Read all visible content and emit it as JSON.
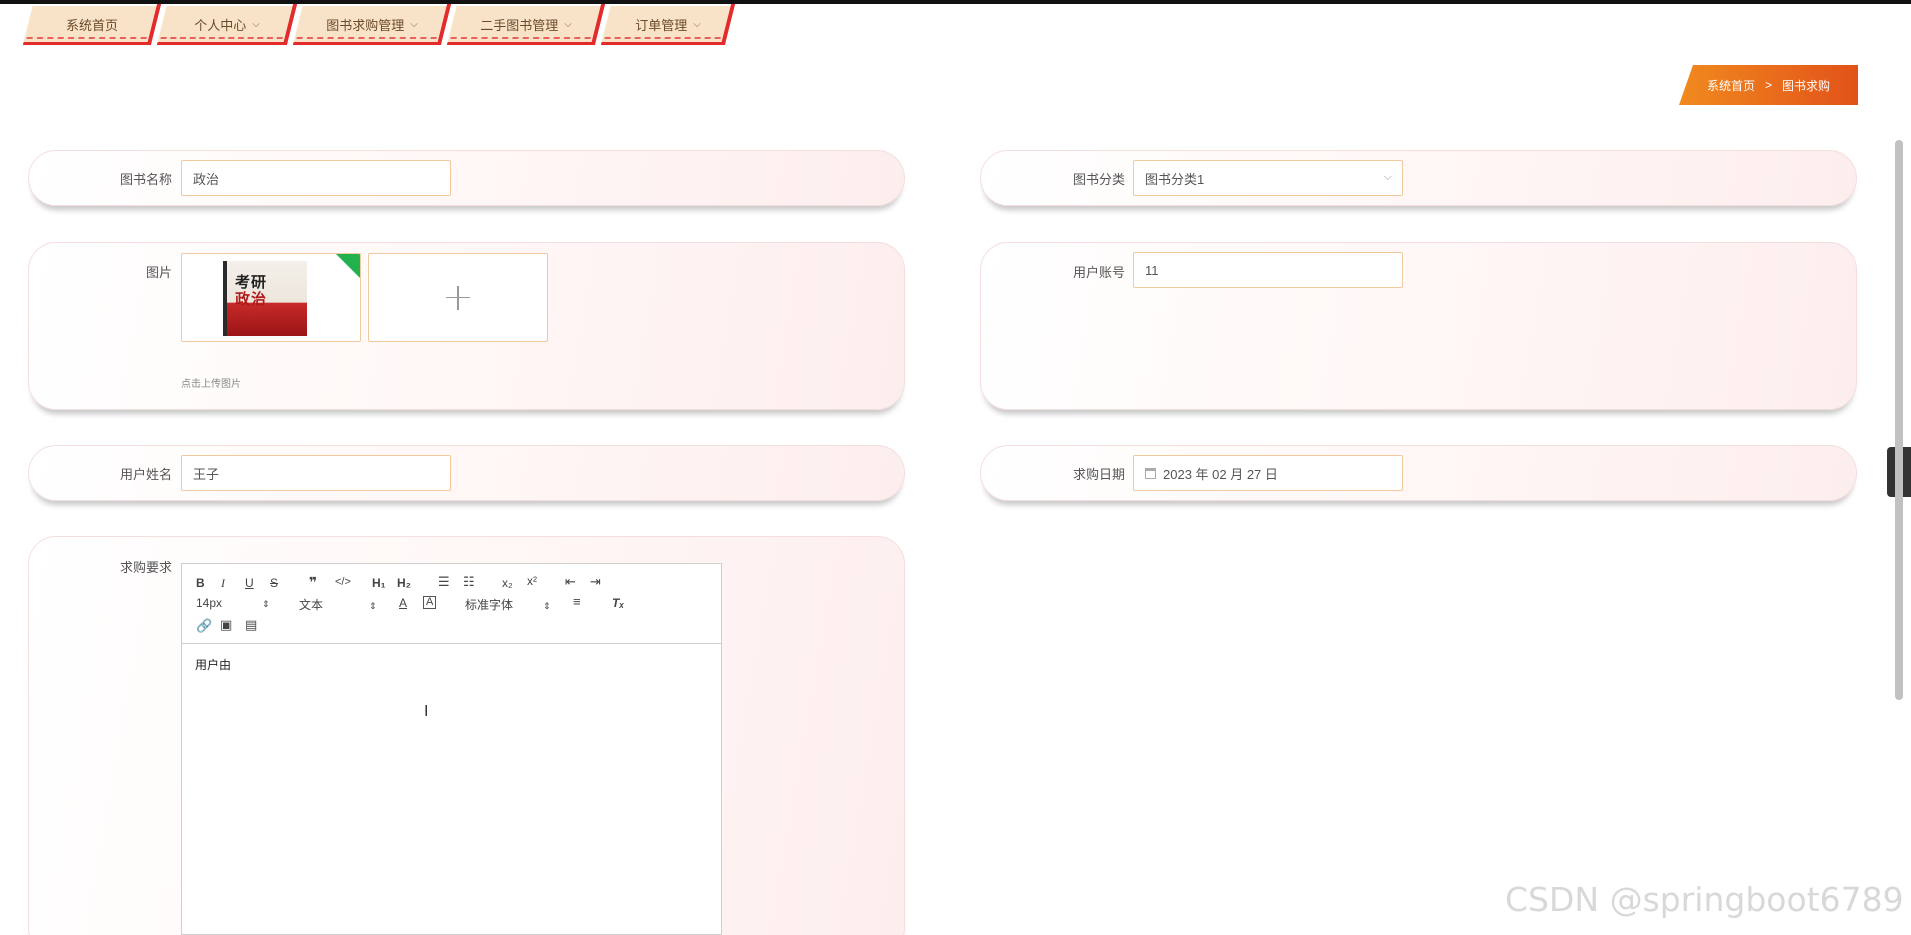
{
  "nav": {
    "items": [
      {
        "label": "系统首页",
        "has_dropdown": false
      },
      {
        "label": "个人中心",
        "has_dropdown": true
      },
      {
        "label": "图书求购管理",
        "has_dropdown": true
      },
      {
        "label": "二手图书管理",
        "has_dropdown": true
      },
      {
        "label": "订单管理",
        "has_dropdown": true
      }
    ]
  },
  "breadcrumb": {
    "home": "系统首页",
    "separator": ">",
    "current": "图书求购"
  },
  "form": {
    "book_name": {
      "label": "图书名称",
      "value": "政治"
    },
    "book_category": {
      "label": "图书分类",
      "value": "图书分类1"
    },
    "image": {
      "label": "图片",
      "hint": "点击上传图片",
      "cover_title_line1": "考研",
      "cover_title_line2": "政治"
    },
    "user_account": {
      "label": "用户账号",
      "value": "11"
    },
    "user_name": {
      "label": "用户姓名",
      "value": "王子"
    },
    "purchase_date": {
      "label": "求购日期",
      "value": "2023 年 02 月 27 日"
    },
    "requirement": {
      "label": "求购要求",
      "content": "用户由"
    }
  },
  "editor_toolbar": {
    "font_size": "14px",
    "header_select": "文本",
    "font_family": "标准字体"
  },
  "watermark": "CSDN @springboot6789",
  "colors": {
    "accent": "#e2521a",
    "input_border": "#f2c89e",
    "tab_bg": "#f9e3c8",
    "tab_border": "#e32b2b"
  }
}
